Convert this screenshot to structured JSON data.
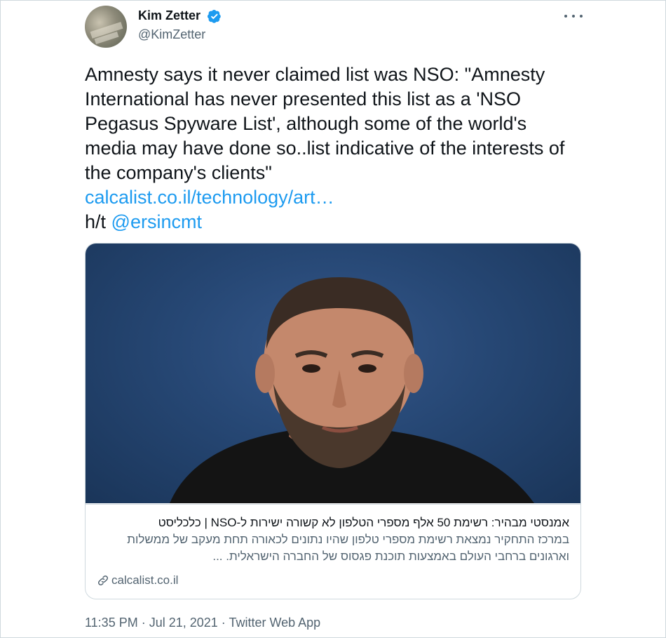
{
  "author": {
    "name": "Kim Zetter",
    "handle": "@KimZetter",
    "verified": true,
    "avatar_icon": "profile-photo"
  },
  "tweet": {
    "text": "Amnesty says it never claimed list was NSO: \"Amnesty International has never presented this list as a 'NSO Pegasus Spyware List', although some of the world's media may have done so..list indicative of the interests of the company's clients\"",
    "link": "calcalist.co.il/technology/art…",
    "ht_prefix": "h/t ",
    "mention": "@ersincmt"
  },
  "card": {
    "title": "אמנסטי מבהיר: רשימת 50 אלף מספרי הטלפון לא קשורה ישירות ל-NSO | כלכליסט",
    "description": "במרכז התחקיר נמצאת רשימת מספרי טלפון שהיו נתונים לכאורה תחת מעקב של ממשלות וארגונים ברחבי העולם באמצעות תוכנת פגסוס של החברה הישראלית. ...",
    "domain": "calcalist.co.il"
  },
  "footer": {
    "time": "11:35 PM",
    "separator": " · ",
    "date": "Jul 21, 2021",
    "source": "Twitter Web App"
  },
  "colors": {
    "accent": "#1d9bf0",
    "text": "#0f1419",
    "muted": "#536471",
    "border": "#cfd9de",
    "card_background": "#264774"
  }
}
